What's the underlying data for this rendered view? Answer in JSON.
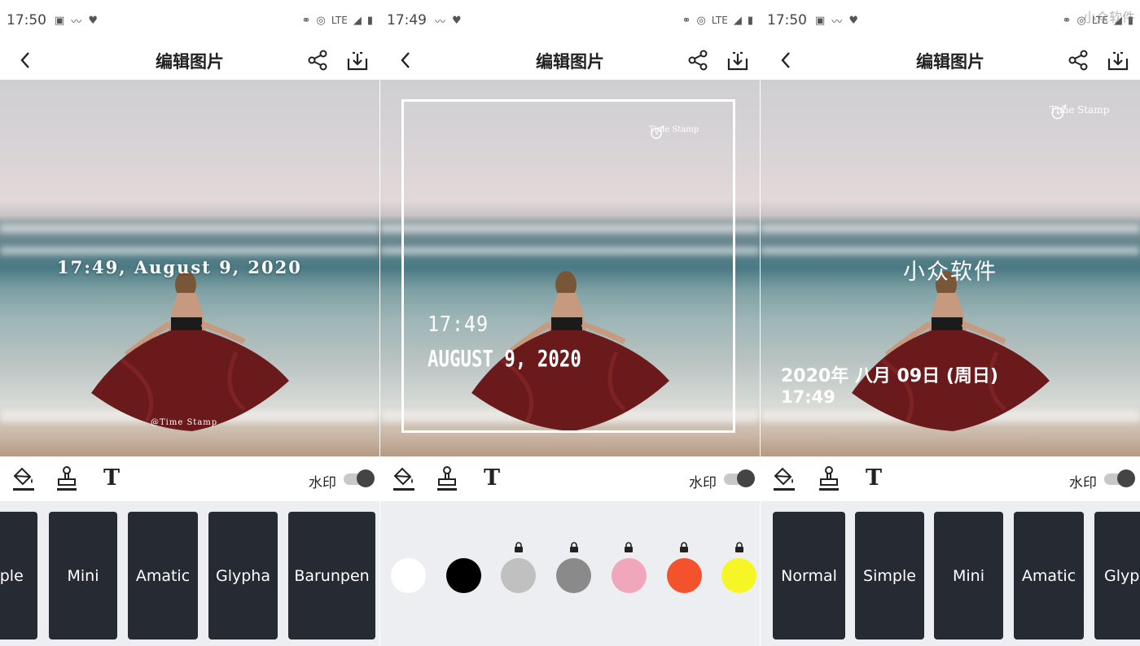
{
  "panels": [
    {
      "status": {
        "time": "17:50",
        "network": "LTE"
      },
      "appbar": {
        "title": "编辑图片"
      },
      "timestamp": {
        "text": "17:49, August 9, 2020",
        "watermark": "@Time Stamp"
      },
      "toolbar": {
        "watermark_label": "水印",
        "watermark_on": true,
        "active_tool": "stamp"
      },
      "styles": [
        "mple",
        "Mini",
        "Amatic",
        "Glypha",
        "Barunpen"
      ]
    },
    {
      "status": {
        "time": "17:49",
        "network": "LTE"
      },
      "appbar": {
        "title": "编辑图片"
      },
      "timestamp": {
        "time": "17:49",
        "date": "AUGUST 9, 2020",
        "logo": "Time Stamp"
      },
      "toolbar": {
        "watermark_label": "水印",
        "watermark_on": true,
        "active_tool": "fill"
      },
      "colors": [
        {
          "hex": "#ffffff",
          "locked": false
        },
        {
          "hex": "#000000",
          "locked": false
        },
        {
          "hex": "#c0c0c0",
          "locked": true
        },
        {
          "hex": "#8a8a8a",
          "locked": true
        },
        {
          "hex": "#f0a7bb",
          "locked": true
        },
        {
          "hex": "#f4522d",
          "locked": true
        },
        {
          "hex": "#f6f626",
          "locked": true
        }
      ]
    },
    {
      "status": {
        "time": "17:50",
        "network": "LTE",
        "corner_watermark": "小众软件"
      },
      "appbar": {
        "title": "编辑图片"
      },
      "timestamp": {
        "title": "小众软件",
        "date": "2020年 八月 09日 (周日)",
        "time": "17:49",
        "logo": "Time Stamp"
      },
      "toolbar": {
        "watermark_label": "水印",
        "watermark_on": true,
        "active_tool": "none"
      },
      "styles": [
        "Normal",
        "Simple",
        "Mini",
        "Amatic",
        "Glyph"
      ]
    }
  ]
}
